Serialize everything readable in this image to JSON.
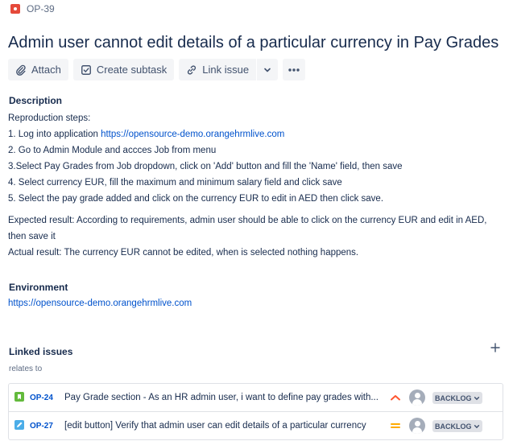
{
  "breadcrumb": {
    "issue_key": "OP-39"
  },
  "issue": {
    "title": "Admin user cannot edit details of a particular currency in Pay Grades"
  },
  "toolbar": {
    "attach": "Attach",
    "create_subtask": "Create subtask",
    "link_issue": "Link issue"
  },
  "description": {
    "heading": "Description",
    "line1": "Reproduction steps:",
    "line2_prefix": "1. Log into application ",
    "line2_link": "https://opensource-demo.orangehrmlive.com",
    "line3": "2. Go to Admin Module and accces Job from menu",
    "line4": "3.Select Pay Grades from Job dropdown, click on 'Add' button and fill the 'Name' field, then save",
    "line5": "4. Select currency EUR, fill the maximum and minimum salary field and click save",
    "line6": "5. Select the pay grade added and click on the currency EUR to edit in AED then click save.",
    "expected_1": "Expected result: According to requirements, admin user should be able to click on the currency EUR and edit in AED,",
    "expected_2": "then save it",
    "actual": "Actual result: The currency EUR cannot be edited, when is selected nothing happens."
  },
  "environment": {
    "heading": "Environment",
    "link": "https://opensource-demo.orangehrmlive.com"
  },
  "linked_issues": {
    "heading": "Linked issues",
    "relation": "relates to",
    "items": [
      {
        "type_icon": "story-icon",
        "key": "OP-24",
        "summary": "Pay Grade section - As an HR admin user, i want to define pay grades with...",
        "priority": "high",
        "status": "BACKLOG"
      },
      {
        "type_icon": "task-icon",
        "key": "OP-27",
        "summary": "[edit button] Verify that admin user can edit details of a particular currency",
        "priority": "medium",
        "status": "BACKLOG"
      }
    ]
  },
  "colors": {
    "link": "#0052cc",
    "bug": "#e5493a",
    "story": "#63ba3c",
    "task": "#4bade8",
    "priority_high": "#ff5630",
    "priority_medium": "#ffab00"
  }
}
